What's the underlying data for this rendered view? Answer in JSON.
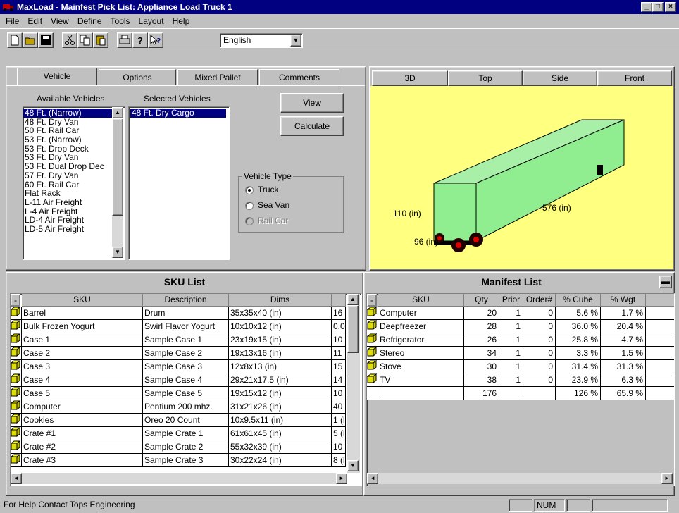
{
  "window": {
    "title": "MaxLoad - Mainfest Pick List: Appliance Load Truck 1"
  },
  "menu": [
    "File",
    "Edit",
    "View",
    "Define",
    "Tools",
    "Layout",
    "Help"
  ],
  "toolbar": {
    "language": "English"
  },
  "tabs": [
    "Vehicle",
    "Options",
    "Mixed Pallet",
    "Comments"
  ],
  "vehicle": {
    "available_label": "Available Vehicles",
    "selected_label": "Selected Vehicles",
    "available": [
      "48 Ft. (Narrow)",
      "48 Ft. Dry Van",
      "50 Ft. Rail Car",
      "53 Ft. (Narrow)",
      "53 Ft. Drop Deck",
      "53 Ft. Dry Van",
      "53 Ft. Dual Drop Dec",
      "57 Ft. Dry Van",
      "60 Ft. Rail Car",
      "Flat Rack",
      "L-11 Air Freight",
      "L-4 Air Freight",
      "LD-4 Air Freight",
      "LD-5 Air Freight"
    ],
    "selected": [
      "48 Ft. Dry Cargo"
    ],
    "view_btn": "View",
    "calc_btn": "Calculate",
    "type_title": "Vehicle Type",
    "types": [
      "Truck",
      "Sea Van",
      "Rail Car"
    ]
  },
  "view_buttons": [
    "3D",
    "Top",
    "Side",
    "Front"
  ],
  "diagram": {
    "height_label": "110 (in)",
    "length_label": "576 (in)",
    "width_label": "96 (in)",
    "colors": {
      "bg": "#ffff80",
      "box": "#90ee90"
    }
  },
  "sku_list": {
    "caption": "SKU List",
    "headers": [
      "SKU",
      "Description",
      "Dims"
    ],
    "rows": [
      [
        "Barrel",
        "Drum",
        "35x35x40 (in)",
        "16"
      ],
      [
        "Bulk Frozen Yogurt",
        "Swirl Flavor Yogurt",
        "10x10x12 (in)",
        "0.0"
      ],
      [
        "Case 1",
        "Sample Case 1",
        "23x19x15 (in)",
        "10"
      ],
      [
        "Case 2",
        "Sample Case 2",
        "19x13x16 (in)",
        "11"
      ],
      [
        "Case 3",
        "Sample Case 3",
        "12x8x13 (in)",
        "15"
      ],
      [
        "Case 4",
        "Sample Case 4",
        "29x21x17.5 (in)",
        "14"
      ],
      [
        "Case 5",
        "Sample Case 5",
        "19x15x12 (in)",
        "10"
      ],
      [
        "Computer",
        "Pentium 200 mhz.",
        "31x21x26 (in)",
        "40"
      ],
      [
        "Cookies",
        "Oreo 20 Count",
        "10x9.5x11 (in)",
        "1 (l"
      ],
      [
        "Crate #1",
        "Sample Crate 1",
        "61x61x45 (in)",
        "5 (l"
      ],
      [
        "Crate #2",
        "Sample Crate 2",
        "55x32x39 (in)",
        "10"
      ],
      [
        "Crate #3",
        "Sample Crate 3",
        "30x22x24 (in)",
        "8 (l"
      ]
    ]
  },
  "manifest": {
    "caption": "Manifest List",
    "headers": [
      "SKU",
      "Qty",
      "Prior",
      "Order#",
      "% Cube",
      "% Wgt"
    ],
    "rows": [
      [
        "Computer",
        "20",
        "1",
        "0",
        "5.6 %",
        "1.7 %"
      ],
      [
        "Deepfreezer",
        "28",
        "1",
        "0",
        "36.0 %",
        "20.4 %"
      ],
      [
        "Refrigerator",
        "26",
        "1",
        "0",
        "25.8 %",
        "4.7 %"
      ],
      [
        "Stereo",
        "34",
        "1",
        "0",
        "3.3 %",
        "1.5 %"
      ],
      [
        "Stove",
        "30",
        "1",
        "0",
        "31.4 %",
        "31.3 %"
      ],
      [
        "TV",
        "38",
        "1",
        "0",
        "23.9 %",
        "6.3 %"
      ]
    ],
    "total": {
      "qty": "176",
      "cube": "126 %",
      "wgt": "65.9 %"
    }
  },
  "status": {
    "help": "For Help Contact Tops Engineering",
    "num": "NUM"
  }
}
